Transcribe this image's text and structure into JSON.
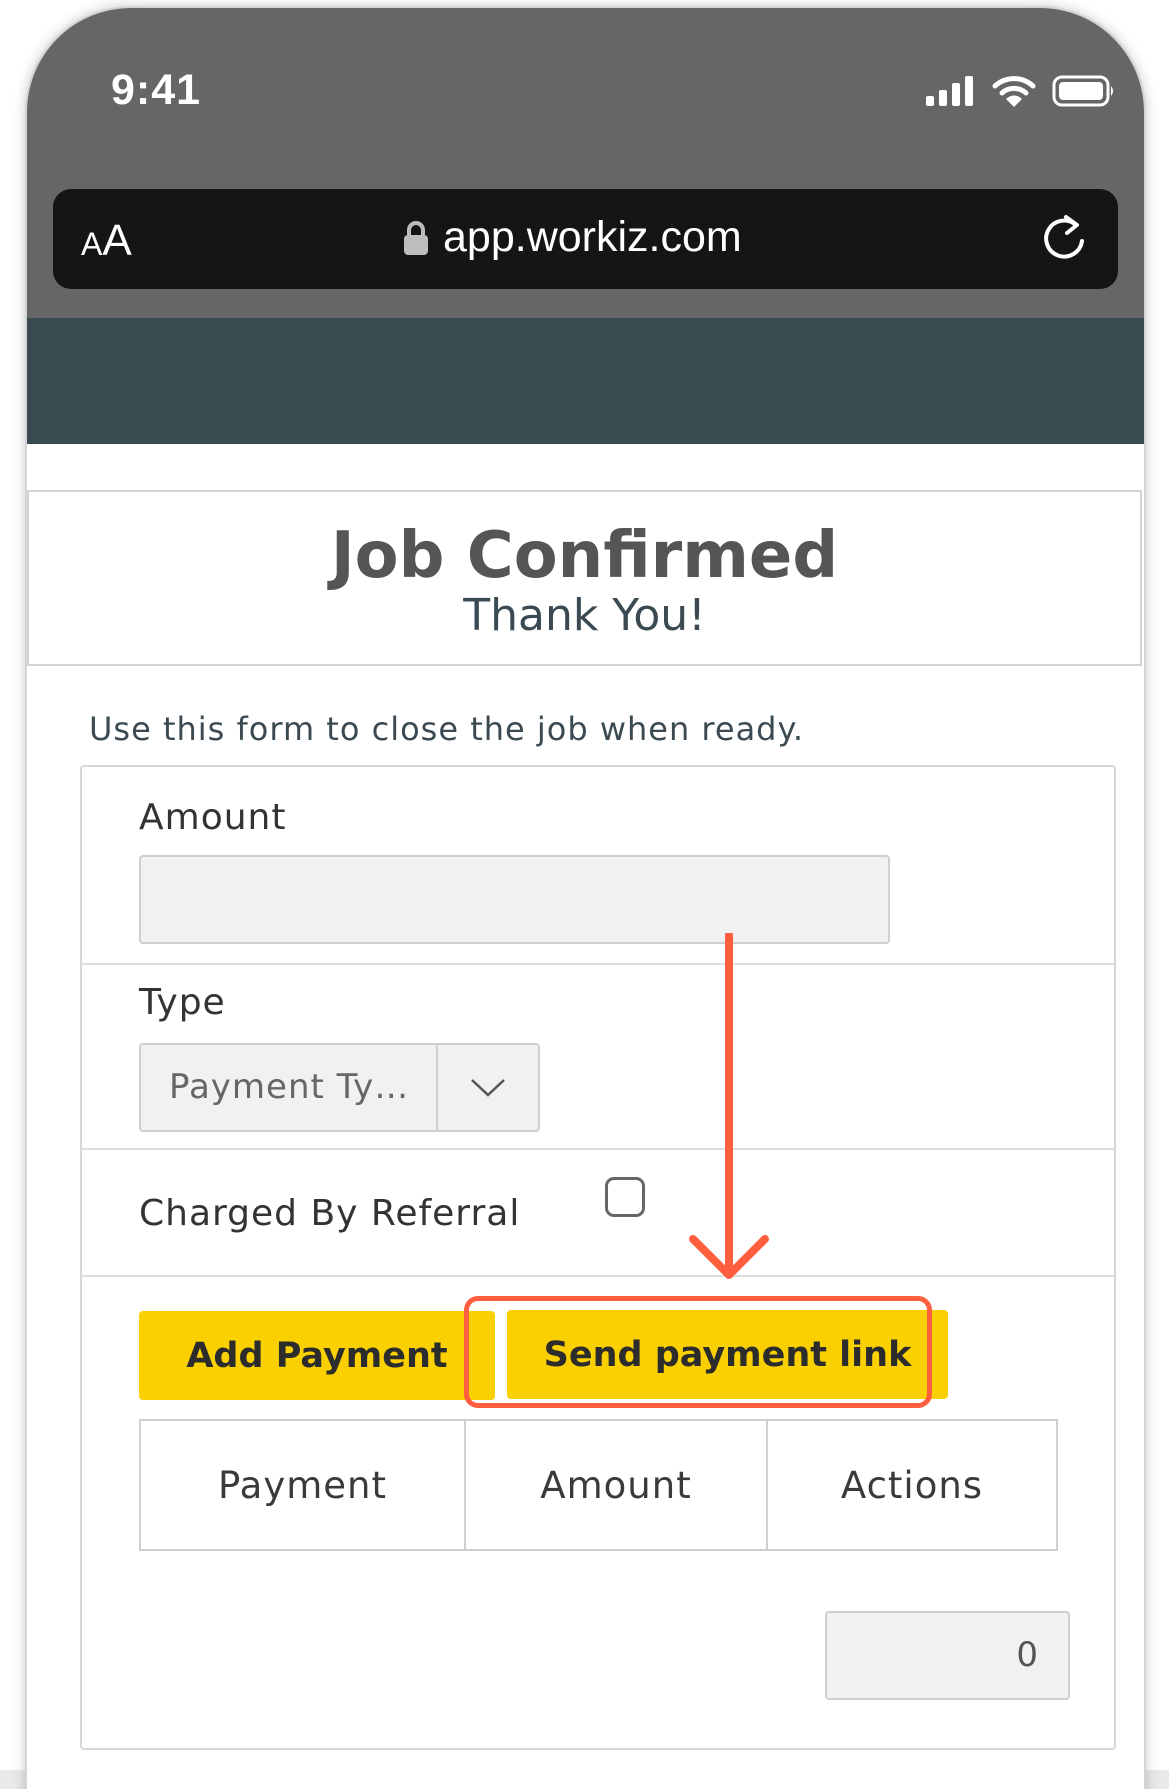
{
  "status_bar": {
    "time": "9:41",
    "icons": [
      "cellular-signal-icon",
      "wifi-icon",
      "battery-icon"
    ]
  },
  "browser": {
    "text_size_big": "A",
    "text_size_small": "A",
    "url": "app.workiz.com",
    "icons": [
      "lock-icon",
      "reload-icon"
    ]
  },
  "colors": {
    "chrome": "#666666",
    "app_header": "#3a4a51",
    "accent_yellow": "#fad000",
    "highlight": "#ff5f3f"
  },
  "page": {
    "title": "Job Confirmed",
    "subtitle": "Thank You!",
    "intro": "Use this form to close the job when ready."
  },
  "form": {
    "amount_label": "Amount",
    "amount_value": "",
    "type_label": "Type",
    "type_value": "Payment Ty…",
    "referral_label": "Charged By Referral",
    "referral_checked": false,
    "add_payment_label": "Add Payment",
    "send_link_label": "Send payment link",
    "table_headers": [
      "Payment",
      "Amount",
      "Actions"
    ],
    "total_value": "0"
  }
}
